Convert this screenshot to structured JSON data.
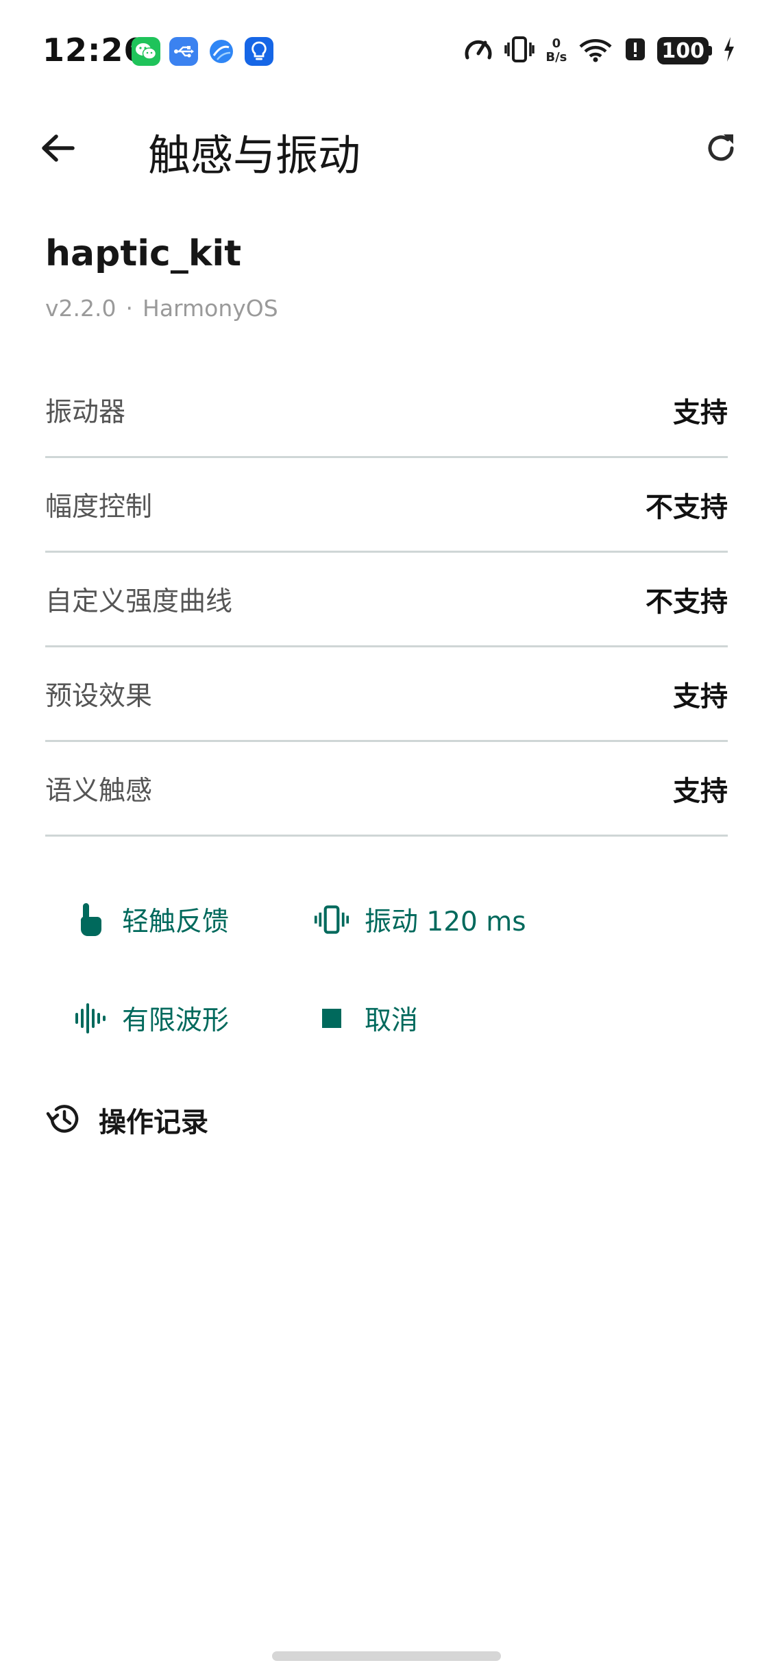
{
  "status_bar": {
    "time": "12:26",
    "app_icons": [
      "wechat-icon",
      "usb-icon",
      "browser-icon",
      "tips-icon"
    ],
    "net_speed_value": "0",
    "net_speed_unit": "B/s",
    "battery": "100",
    "status_icons": [
      "speedometer-icon",
      "vibrate-mode-icon",
      "wifi-icon",
      "alert-icon",
      "charging-icon"
    ]
  },
  "app_bar": {
    "title": "触感与振动",
    "back_icon": "back-arrow-icon",
    "refresh_icon": "refresh-icon"
  },
  "header": {
    "name": "haptic_kit",
    "version": "v2.2.0",
    "separator": "·",
    "platform": "HarmonyOS"
  },
  "capabilities": [
    {
      "label": "振动器",
      "value": "支持"
    },
    {
      "label": "幅度控制",
      "value": "不支持"
    },
    {
      "label": "自定义强度曲线",
      "value": "不支持"
    },
    {
      "label": "预设效果",
      "value": "支持"
    },
    {
      "label": "语义触感",
      "value": "支持"
    }
  ],
  "actions": {
    "tap_feedback": {
      "label": "轻触反馈",
      "icon": "touch-hand-icon"
    },
    "vibrate": {
      "label": "振动 120 ms",
      "icon": "vibrate-icon"
    },
    "waveform": {
      "label": "有限波形",
      "icon": "waveform-icon"
    },
    "cancel": {
      "label": "取消",
      "icon": "stop-icon"
    }
  },
  "log": {
    "title": "操作记录",
    "icon": "history-icon"
  },
  "colors": {
    "accent": "#00695c",
    "divider": "#cfd6d6",
    "secondary_text": "#9a9a9a"
  }
}
